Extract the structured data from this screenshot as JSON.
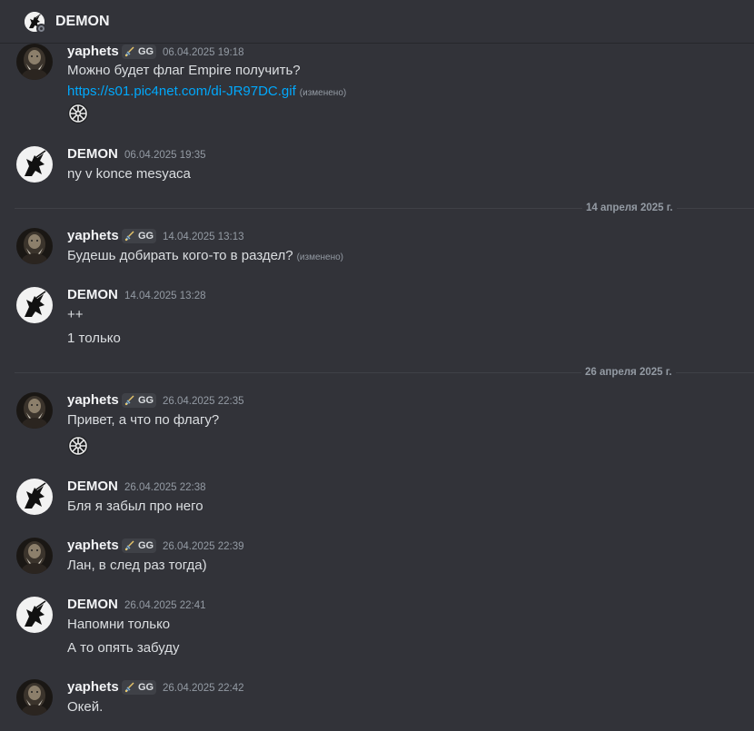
{
  "channel": {
    "title": "DEMON",
    "icon": "demon-avatar-icon"
  },
  "tag": {
    "label": "GG",
    "icon": "sword-icon"
  },
  "dividers": [
    {
      "label": "14 апреля 2025 г."
    },
    {
      "label": "26 апреля 2025 г."
    }
  ],
  "messages": [
    {
      "author": "yaphets",
      "time": "06.04.2025 19:18",
      "line1": "Можно будет флаг Empire получить?",
      "link": "https://s01.pic4net.com/di-JR97DC.gif",
      "link_edited": "(изменено)",
      "emoji": "imperial-emblem-icon"
    },
    {
      "author": "DEMON",
      "time": "06.04.2025 19:35",
      "line1": "ny v konce mesyaca"
    },
    {
      "author": "yaphets",
      "time": "14.04.2025 13:13",
      "line1": "Будешь добирать кого-то в раздел?",
      "edited": "(изменено)"
    },
    {
      "author": "DEMON",
      "time": "14.04.2025 13:28",
      "line1": "++",
      "line2": "1 только"
    },
    {
      "author": "yaphets",
      "time": "26.04.2025 22:35",
      "line1": "Привет, а что по флагу?",
      "emoji": "imperial-emblem-icon"
    },
    {
      "author": "DEMON",
      "time": "26.04.2025 22:38",
      "line1": "Бля я забыл про него"
    },
    {
      "author": "yaphets",
      "time": "26.04.2025 22:39",
      "line1": "Лан, в след раз тогда)"
    },
    {
      "author": "DEMON",
      "time": "26.04.2025 22:41",
      "line1": "Напомни только",
      "line2": "А то опять забуду"
    },
    {
      "author": "yaphets",
      "time": "26.04.2025 22:42",
      "line1": "Окей."
    }
  ]
}
